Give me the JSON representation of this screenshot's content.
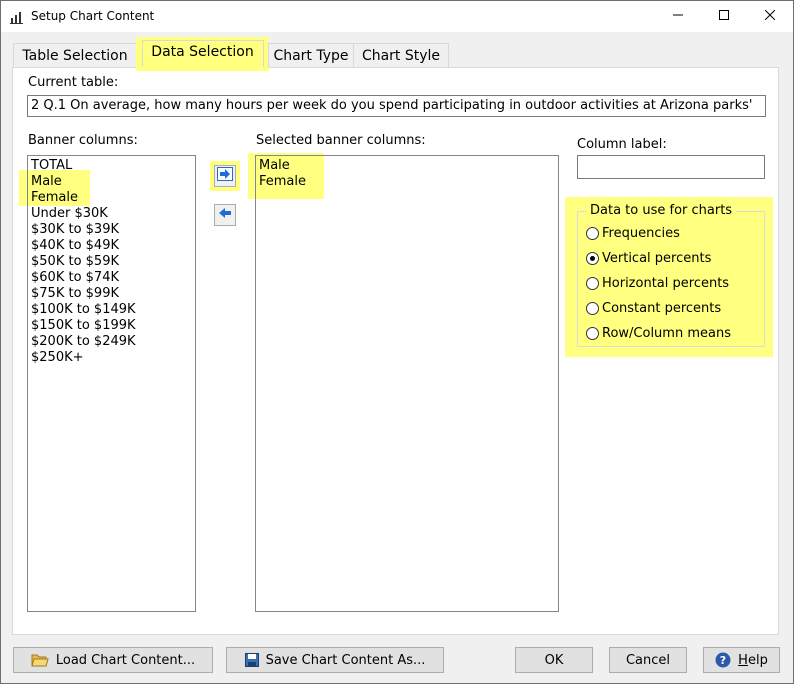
{
  "window": {
    "title": "Setup Chart Content",
    "app_icon": "chart-gear-icon",
    "controls": {
      "minimize": "minimize-icon",
      "maximize": "maximize-icon",
      "close": "close-icon"
    }
  },
  "tabs": [
    {
      "label": "Table Selection",
      "active": false
    },
    {
      "label": "Data Selection",
      "active": true
    },
    {
      "label": "Chart Type",
      "active": false
    },
    {
      "label": "Chart Style",
      "active": false
    }
  ],
  "current_table": {
    "label": "Current table:",
    "value": "2 Q.1 On average, how many hours per week do you spend participating in outdoor activities at Arizona parks'"
  },
  "banner_columns": {
    "label": "Banner columns:",
    "items": [
      "TOTAL",
      "Male",
      "Female",
      "Under $30K",
      "$30K to $39K",
      "$40K to $49K",
      "$50K to $59K",
      "$60K to $74K",
      "$75K to $99K",
      "$100K to $149K",
      "$150K to $199K",
      "$200K to $249K",
      "$250K+"
    ]
  },
  "selected_banner_columns": {
    "label": "Selected banner columns:",
    "items": [
      "Male",
      "Female"
    ]
  },
  "arrows": {
    "add": "arrow-right-icon",
    "remove": "arrow-left-icon"
  },
  "column_label": {
    "label": "Column label:",
    "value": ""
  },
  "data_group": {
    "title": "Data to use for charts",
    "options": [
      {
        "label": "Frequencies",
        "checked": false
      },
      {
        "label": "Vertical percents",
        "checked": true
      },
      {
        "label": "Horizontal percents",
        "checked": false
      },
      {
        "label": "Constant percents",
        "checked": false
      },
      {
        "label": "Row/Column means",
        "checked": false
      }
    ]
  },
  "buttons": {
    "load": "Load Chart Content...",
    "save": "Save Chart Content As...",
    "ok": "OK",
    "cancel": "Cancel",
    "help_prefix": "",
    "help_underlined": "H",
    "help_rest": "elp"
  },
  "colors": {
    "highlight": "#ffff80",
    "window_bg": "#f0f0f0",
    "arrow_blue": "#1f6fd1"
  }
}
